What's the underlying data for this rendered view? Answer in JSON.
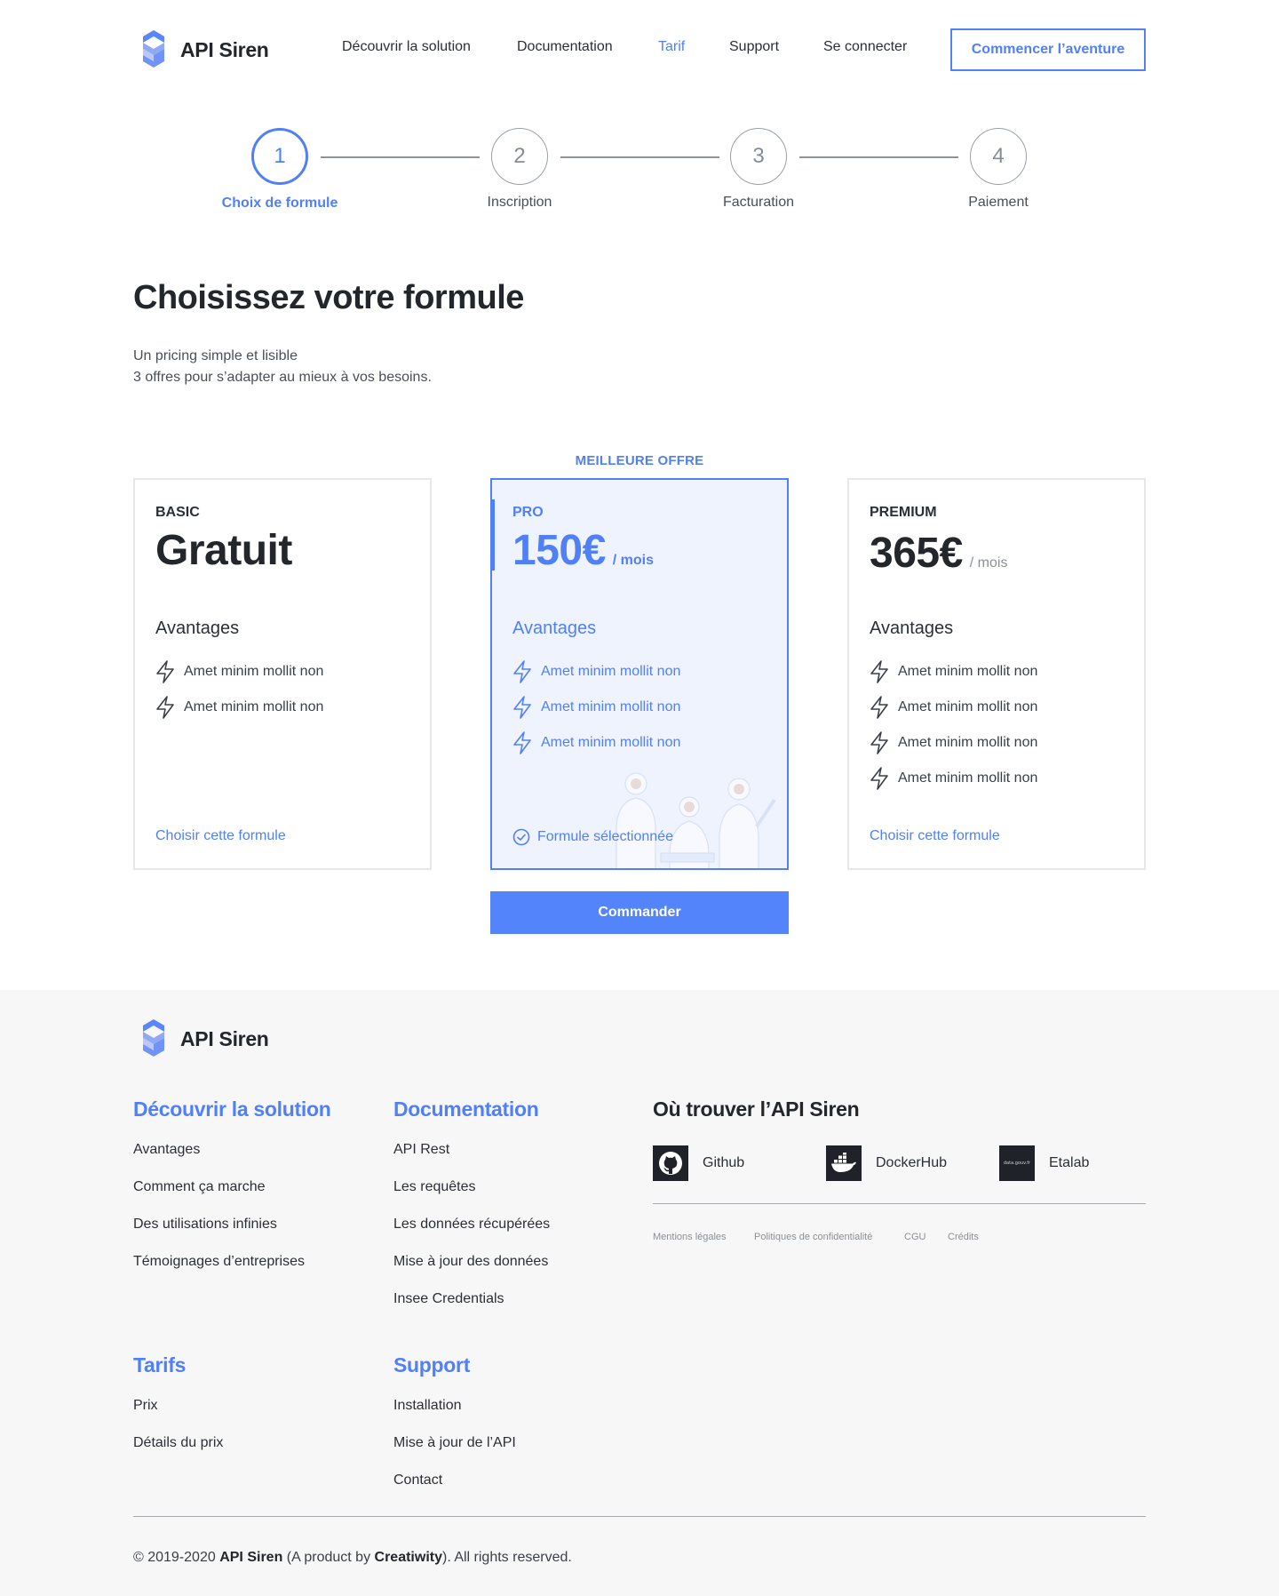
{
  "brand": {
    "name": "API Siren"
  },
  "nav": {
    "items": [
      "Découvrir la solution",
      "Documentation",
      "Tarif",
      "Support",
      "Se connecter"
    ],
    "active": "Tarif",
    "cta": "Commencer l’aventure"
  },
  "stepper": {
    "steps": [
      {
        "number": "1",
        "label": "Choix de formule",
        "active": true
      },
      {
        "number": "2",
        "label": "Inscription",
        "active": false
      },
      {
        "number": "3",
        "label": "Facturation",
        "active": false
      },
      {
        "number": "4",
        "label": "Paiement",
        "active": false
      }
    ]
  },
  "page": {
    "title": "Choisissez votre formule",
    "subtitle_line1": "Un pricing simple et lisible",
    "subtitle_line2": "3 offres pour s’adapter au mieux à vos besoins."
  },
  "plans": {
    "best_offer_label": "MEILLEURE OFFRE",
    "basic": {
      "name": "BASIC",
      "price": "Gratuit",
      "advantages_title": "Avantages",
      "features": [
        "Amet minim mollit non",
        "Amet minim mollit non"
      ],
      "action": "Choisir cette formule"
    },
    "pro": {
      "name": "PRO",
      "price": "150€",
      "period": "/ mois",
      "advantages_title": "Avantages",
      "features": [
        "Amet minim mollit non",
        "Amet minim mollit non",
        "Amet minim mollit non"
      ],
      "action": "Formule sélectionnée",
      "selected": true
    },
    "premium": {
      "name": "PREMIUM",
      "price": "365€",
      "period": "/ mois",
      "advantages_title": "Avantages",
      "features": [
        "Amet minim mollit non",
        "Amet minim mollit non",
        "Amet minim mollit non",
        "Amet minim mollit non"
      ],
      "action": "Choisir cette formule"
    },
    "order_button": "Commander"
  },
  "footer": {
    "columns": {
      "solution": {
        "title": "Découvrir la solution",
        "links": [
          "Avantages",
          "Comment ça marche",
          "Des utilisations infinies",
          "Témoignages d’entreprises"
        ]
      },
      "documentation": {
        "title": "Documentation",
        "links": [
          "API Rest",
          "Les requêtes",
          "Les données récupérées",
          "Mise à jour des données",
          "Insee Credentials"
        ]
      },
      "tarifs": {
        "title": "Tarifs",
        "links": [
          "Prix",
          "Détails du prix"
        ]
      },
      "support": {
        "title": "Support",
        "links": [
          "Installation",
          "Mise à jour de l’API",
          "Contact"
        ]
      }
    },
    "where": {
      "title": "Où trouver l’API Siren",
      "repos": [
        {
          "name": "Github",
          "icon": "github-icon"
        },
        {
          "name": "DockerHub",
          "icon": "docker-icon"
        },
        {
          "name": "Etalab",
          "icon": "etalab-icon",
          "icon_text": "data.gouv.fr"
        }
      ]
    },
    "legal": [
      "Mentions légales",
      "Politiques de confidentialité",
      "CGU",
      "Crédits"
    ],
    "copyright": {
      "prefix": "© 2019-2020 ",
      "brand": "API Siren",
      "middle": " (A product by ",
      "company": "Creatiwity",
      "suffix": "). All rights reserved."
    }
  },
  "colors": {
    "accent": "#5180f6",
    "text": "#23262b",
    "footer_bg": "#f7f7f7",
    "pro_bg": "#eef3fe"
  }
}
